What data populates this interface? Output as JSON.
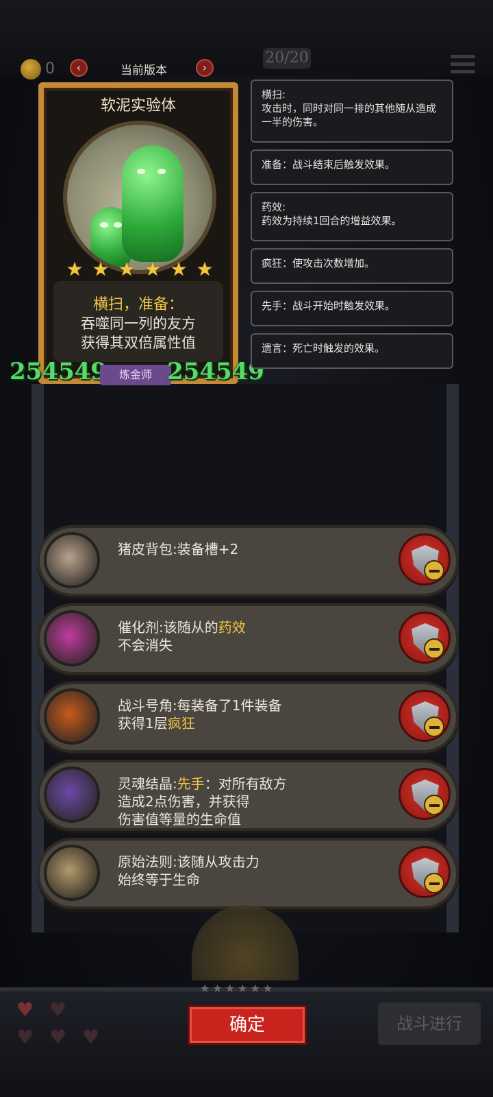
{
  "topbar": {
    "coin_count": "0",
    "version_label": "当前版本",
    "prev_label": "‹",
    "next_label": "›",
    "counter": "20/20"
  },
  "unit": {
    "name": "软泥实验体",
    "stars": 6,
    "keywords": "横扫，准备：",
    "desc_line1": "吞噬同一列的友方",
    "desc_line2": "获得其双倍属性值",
    "attack": "254549",
    "health": "254549",
    "class": "炼金师"
  },
  "keywords": [
    {
      "title": "横扫:",
      "text": "攻击时，同时对同一排的其他随从造成一半的伤害。"
    },
    {
      "title": "",
      "text": "准备：战斗结束后触发效果。"
    },
    {
      "title": "药效:",
      "text": "药效为持续1回合的增益效果。"
    },
    {
      "title": "",
      "text": "疯狂：使攻击次数增加。"
    },
    {
      "title": "",
      "text": "先手：战斗开始时触发效果。"
    },
    {
      "title": "",
      "text": "遗言：死亡时触发的效果。"
    }
  ],
  "equipment": [
    {
      "name": "猪皮背包",
      "desc_pre": "猪皮背包:装备槽+2",
      "hl": "",
      "desc_post": "",
      "line2": "",
      "line3": "",
      "icon": "pig-backpack-icon",
      "color": "#b9a38e"
    },
    {
      "desc_pre": "催化剂:该随从的",
      "hl": "药效",
      "desc_post": "",
      "line2": "不会消失",
      "line3": "",
      "icon": "catalyst-icon",
      "color": "#c13ba0"
    },
    {
      "desc_pre": "战斗号角:每装备了1件装备",
      "hl": "",
      "desc_post": "",
      "line2_pre": "获得1层",
      "line2_hl": "疯狂",
      "line3": "",
      "icon": "battle-horn-icon",
      "color": "#c85a1c"
    },
    {
      "desc_pre": "灵魂结晶:",
      "hl": "先手",
      "desc_post": "：对所有敌方",
      "line2": "造成2点伤害，并获得",
      "line3": "伤害值等量的生命值",
      "icon": "soul-crystal-icon",
      "color": "#6b4aa8"
    },
    {
      "desc_pre": "原始法则:该随从攻击力",
      "hl": "",
      "desc_post": "",
      "line2": "始终等于生命",
      "line3": "",
      "icon": "primal-law-icon",
      "color": "#b29a6c"
    }
  ],
  "bottom": {
    "confirm_label": "确定",
    "battle_label": "战斗进行",
    "bottom_stars": "★★★★★★"
  },
  "colors": {
    "highlight": "#f2c644",
    "stat_green": "#58d96a",
    "confirm_red": "#c8231d"
  }
}
